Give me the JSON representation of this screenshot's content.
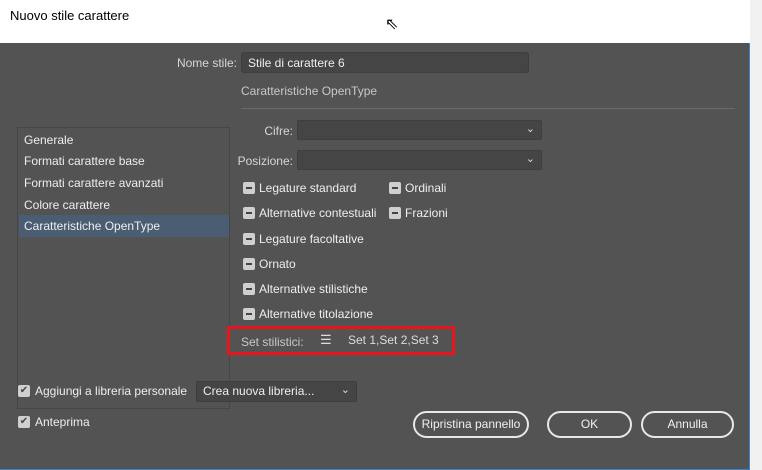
{
  "window": {
    "title": "Nuovo stile carattere"
  },
  "style_name": {
    "label": "Nome stile:",
    "value": "Stile di carattere 6"
  },
  "sidebar": {
    "items": [
      {
        "label": "Generale"
      },
      {
        "label": "Formati carattere base"
      },
      {
        "label": "Formati carattere avanzati"
      },
      {
        "label": "Colore carattere"
      },
      {
        "label": "Caratteristiche OpenType",
        "selected": true
      }
    ]
  },
  "section": {
    "title": "Caratteristiche OpenType",
    "cifre": {
      "label": "Cifre:",
      "value": ""
    },
    "posizione": {
      "label": "Posizione:",
      "value": ""
    },
    "checkboxes": [
      "Legature standard",
      "Ordinali",
      "Alternative contestuali",
      "Frazioni",
      "Legature facoltative",
      "Ornato",
      "Alternative stilistiche",
      "Alternative titolazione"
    ],
    "stylistic_sets": {
      "label": "Set stilistici:",
      "value": "Set 1,Set 2,Set 3",
      "icon": "list-icon"
    }
  },
  "footer": {
    "add_library": {
      "label": "Aggiungi a libreria personale",
      "checked": true,
      "select": "Crea nuova libreria..."
    },
    "preview": {
      "label": "Anteprima",
      "checked": true
    },
    "buttons": {
      "reset": "Ripristina pannello",
      "ok": "OK",
      "cancel": "Annulla"
    }
  },
  "colors": {
    "highlight": "#e8141e",
    "selected": "#4a5d72",
    "background": "#535353"
  }
}
